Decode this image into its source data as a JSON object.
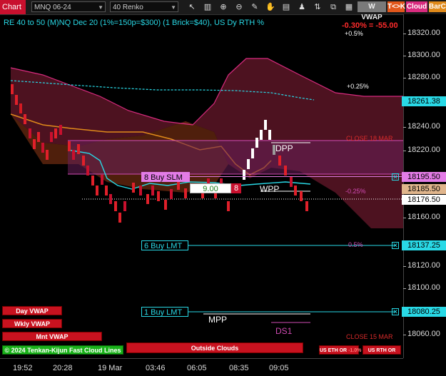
{
  "toolbar": {
    "chart_tab": "Chart",
    "instrument": "MNQ 06-24",
    "bar_type": "40 Renko",
    "buttons": {
      "wvwap": "W VWAP",
      "tk": "T<>K",
      "cloud": "Cloud",
      "barco": "BarCo"
    }
  },
  "chart": {
    "title": "RE 40 to 50 (M)NQ Dec 20 (1%=150p=$300) (1 Brick=$40), US Dy RTH %",
    "pct_change": "-0.30% = -55.00"
  },
  "price_axis": {
    "ticks": [
      "18320.00",
      "18300.00",
      "18280.00",
      "18240.00",
      "18220.00",
      "18160.00",
      "18120.00",
      "18100.00",
      "18060.00"
    ],
    "boxes": [
      {
        "label": "18261.38",
        "bg": "#29d9e6"
      },
      {
        "label": "18195.50",
        "bg": "#e37ce6"
      },
      {
        "label": "18185.50",
        "bg": "#e0b58c"
      },
      {
        "label": "18176.50",
        "bg": "#ffffff"
      },
      {
        "label": "18137.25",
        "bg": "#29d9e6"
      },
      {
        "label": "18080.25",
        "bg": "#29d9e6"
      }
    ]
  },
  "time_axis": [
    "19:52",
    "20:28",
    "19 Mar",
    "03:46",
    "06:05",
    "08:35",
    "09:05"
  ],
  "levels": {
    "plus_05": "+0.5%",
    "plus_025": "+0.25%",
    "close_18": "CLOSE 18 MAR",
    "minus_025": "-0.25%",
    "minus_05": "0.5%",
    "close_15": "CLOSE 15 MAR",
    "minus_pct": "-1.0%",
    "dpp": "DPP",
    "wpp": "WPP",
    "mpp": "MPP",
    "ds1": "DS1"
  },
  "orders": {
    "buy_slm": "8 Buy SLM",
    "qty_price": "9.00",
    "qty": "8",
    "buy_lmt_6": "6 Buy LMT",
    "buy_lmt_1": "1 Buy LMT",
    "close_x": "✕"
  },
  "indicator_buttons": {
    "day_vwap": "Day VWAP",
    "wkly_vwap": "Wkly VWAP",
    "mnt_vwap": "Mnt VWAP",
    "tenkan": "Tenkan-Kijun Fast Cloud Lines",
    "copyright": "© 2024",
    "outside_clouds": "Outside Clouds",
    "us_eth_or": "US ETH OR",
    "us_rth_or": "US RTH OR"
  },
  "icons": [
    "cursor-icon",
    "zoom-in-icon",
    "zoom-out-icon",
    "bar-type-icon",
    "draw-icon",
    "hand-icon",
    "properties-icon",
    "strategy-icon",
    "trade-icon",
    "share-icon"
  ],
  "colors": {
    "accent_cyan": "#29d9e6",
    "chart_red": "#c8102e",
    "cloud_magenta": "#d92b7f",
    "orange": "#e08a1a"
  }
}
